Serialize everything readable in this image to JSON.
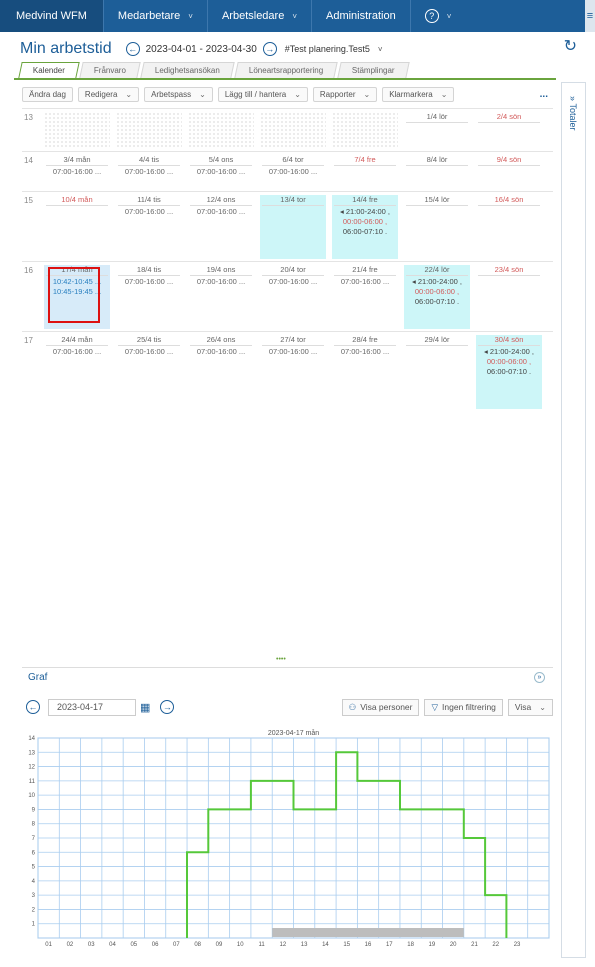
{
  "nav": {
    "brand": "Medvind WFM",
    "items": [
      "Medarbetare",
      "Arbetsledare",
      "Administration"
    ],
    "help": "?",
    "menu": "≡"
  },
  "header": {
    "title": "Min arbetstid",
    "range": "2023-04-01 - 2023-04-30",
    "group": "#Test planering.Test5"
  },
  "tabs": [
    "Kalender",
    "Frånvaro",
    "Ledighetsansökan",
    "Löneartsrapportering",
    "Stämplingar"
  ],
  "toolbar": {
    "buttons": [
      "Ändra dag",
      "Redigera",
      "Arbetspass",
      "Lägg till / hantera",
      "Rapporter",
      "Klarmarkera"
    ],
    "more": "..."
  },
  "side_panel": {
    "label": "Totaler",
    "icon": "»"
  },
  "calendar": {
    "weeks": [
      {
        "no": "13",
        "days": [
          {
            "label": "",
            "dotted": true
          },
          {
            "label": "",
            "dotted": true
          },
          {
            "label": "",
            "dotted": true
          },
          {
            "label": "",
            "dotted": true
          },
          {
            "label": "",
            "dotted": true
          },
          {
            "label": "1/4 lör",
            "shifts": []
          },
          {
            "label": "2/4 sön",
            "red": true,
            "shifts": []
          }
        ]
      },
      {
        "no": "14",
        "days": [
          {
            "label": "3/4 mån",
            "shifts": [
              "07:00-16:00 ..."
            ]
          },
          {
            "label": "4/4 tis",
            "shifts": [
              "07:00-16:00 ..."
            ]
          },
          {
            "label": "5/4 ons",
            "shifts": [
              "07:00-16:00 ..."
            ]
          },
          {
            "label": "6/4 tor",
            "shifts": [
              "07:00-16:00 ..."
            ]
          },
          {
            "label": "7/4 fre",
            "red": true,
            "shifts": []
          },
          {
            "label": "8/4 lör",
            "shifts": []
          },
          {
            "label": "9/4 sön",
            "red": true,
            "shifts": []
          }
        ]
      },
      {
        "no": "15",
        "days": [
          {
            "label": "10/4 mån",
            "red": true,
            "shifts": []
          },
          {
            "label": "11/4 tis",
            "shifts": [
              "07:00-16:00 ..."
            ]
          },
          {
            "label": "12/4 ons",
            "shifts": [
              "07:00-16:00 ..."
            ]
          },
          {
            "label": "13/4 tor",
            "cyan": true,
            "shifts": []
          },
          {
            "label": "14/4 fre",
            "cyan": true,
            "shifts": [
              "◂ 21:00-24:00 ,",
              "00:00-06:00 ,",
              "06:00-07:10 ."
            ]
          },
          {
            "label": "15/4 lör",
            "shifts": []
          },
          {
            "label": "16/4 sön",
            "red": true,
            "shifts": []
          }
        ]
      },
      {
        "no": "16",
        "days": [
          {
            "label": "17/4 mån",
            "selected": true,
            "shifts": [
              "10:42-10:45 ...",
              "10:45-19:45 ..."
            ]
          },
          {
            "label": "18/4 tis",
            "shifts": [
              "07:00-16:00 ..."
            ]
          },
          {
            "label": "19/4 ons",
            "shifts": [
              "07:00-16:00 ..."
            ]
          },
          {
            "label": "20/4 tor",
            "shifts": [
              "07:00-16:00 ..."
            ]
          },
          {
            "label": "21/4 fre",
            "shifts": [
              "07:00-16:00 ..."
            ]
          },
          {
            "label": "22/4 lör",
            "cyan": true,
            "shifts": [
              "◂ 21:00-24:00 ,",
              "00:00-06:00 ,",
              "06:00-07:10 ."
            ]
          },
          {
            "label": "23/4 sön",
            "red": true,
            "shifts": []
          }
        ]
      },
      {
        "no": "17",
        "days": [
          {
            "label": "24/4 mån",
            "shifts": [
              "07:00-16:00 ..."
            ]
          },
          {
            "label": "25/4 tis",
            "shifts": [
              "07:00-16:00 ..."
            ]
          },
          {
            "label": "26/4 ons",
            "shifts": [
              "07:00-16:00 ..."
            ]
          },
          {
            "label": "27/4 tor",
            "shifts": [
              "07:00-16:00 ..."
            ]
          },
          {
            "label": "28/4 fre",
            "shifts": [
              "07:00-16:00 ..."
            ]
          },
          {
            "label": "29/4 lör",
            "shifts": []
          },
          {
            "label": "30/4 sön",
            "red": true,
            "cyan": true,
            "shifts": [
              "◂ 21:00-24:00 ,",
              "00:00-06:00 ,",
              "06:00-07:10 ."
            ]
          }
        ]
      }
    ]
  },
  "graph": {
    "title": "Graf",
    "date": "2023-04-17",
    "buttons": [
      "Visa personer",
      "Ingen filtrering",
      "Visa"
    ]
  },
  "chart_data": {
    "type": "line",
    "title": "2023-04-17 mån",
    "x_ticks": [
      "01",
      "02",
      "03",
      "04",
      "05",
      "06",
      "07",
      "08",
      "09",
      "10",
      "11",
      "12",
      "13",
      "14",
      "15",
      "16",
      "17",
      "18",
      "19",
      "20",
      "21",
      "22",
      "23"
    ],
    "y_ticks": [
      "1",
      "2",
      "3",
      "4",
      "5",
      "6",
      "7",
      "8",
      "9",
      "10",
      "11",
      "12",
      "13",
      "14"
    ],
    "ylim": [
      0,
      14
    ],
    "xlim": [
      0,
      24
    ],
    "series": [
      {
        "color": "#55c83a",
        "step_points": [
          [
            7,
            0
          ],
          [
            7,
            6
          ],
          [
            8,
            6
          ],
          [
            8,
            9
          ],
          [
            10,
            9
          ],
          [
            10,
            11
          ],
          [
            12,
            11
          ],
          [
            12,
            9
          ],
          [
            14,
            9
          ],
          [
            14,
            13
          ],
          [
            15,
            13
          ],
          [
            15,
            11
          ],
          [
            17,
            11
          ],
          [
            17,
            9
          ],
          [
            20,
            9
          ],
          [
            20,
            7
          ],
          [
            21,
            7
          ],
          [
            21,
            3
          ],
          [
            22,
            3
          ],
          [
            22,
            0
          ]
        ]
      }
    ],
    "band": {
      "from": 11,
      "to": 20,
      "color": "#bdbdbd"
    },
    "grid": true
  }
}
